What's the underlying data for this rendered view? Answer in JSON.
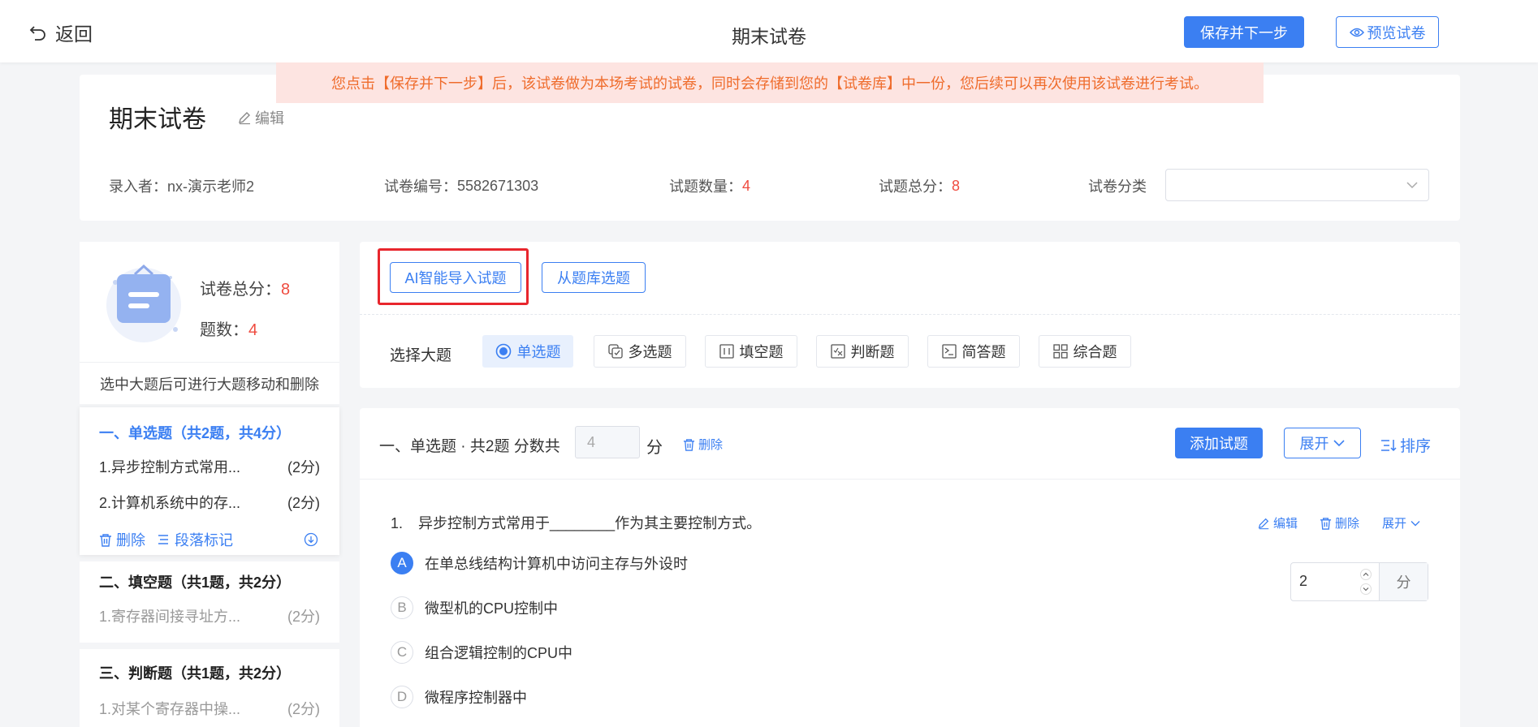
{
  "header": {
    "back_label": "返回",
    "title": "期末试卷",
    "save_next_label": "保存并下一步",
    "preview_label": "预览试卷"
  },
  "notice": "您点击【保存并下一步】后，该试卷做为本场考试的试卷，同时会存储到您的【试卷库】中一份，您后续可以再次使用该试卷进行考试。",
  "paper": {
    "title": "期末试卷",
    "edit_label": "编辑",
    "creator_label": "录入者：",
    "creator": "nx-演示老师2",
    "code_label": "试卷编号：",
    "code": "5582671303",
    "count_label": "试题数量：",
    "count": "4",
    "total_label": "试题总分：",
    "total": "8",
    "category_label": "试卷分类",
    "category_value": ""
  },
  "sidebar": {
    "total_label": "试卷总分：",
    "total": "8",
    "count_label": "题数：",
    "count": "4",
    "hint": "选中大题后可进行大题移动和删除",
    "sections": [
      {
        "title": "一、单选题（共2题，共4分）",
        "items": [
          {
            "text": "1.异步控制方式常用...",
            "score": "(2分)"
          },
          {
            "text": "2.计算机系统中的存...",
            "score": "(2分)"
          }
        ],
        "delete_label": "删除",
        "mark_label": "段落标记"
      },
      {
        "title": "二、填空题（共1题，共2分）",
        "items": [
          {
            "text": "1.寄存器间接寻址方...",
            "score": "(2分)"
          }
        ]
      },
      {
        "title": "三、判断题（共1题，共2分）",
        "items": [
          {
            "text": "1.对某个寄存器中操...",
            "score": "(2分)"
          }
        ]
      }
    ]
  },
  "toolbar": {
    "ai_import_label": "AI智能导入试题",
    "from_bank_label": "从题库选题",
    "choose_label": "选择大题",
    "types": [
      {
        "label": "单选题",
        "icon": "radio-icon",
        "active": true
      },
      {
        "label": "多选题",
        "icon": "multi-select-icon",
        "active": false
      },
      {
        "label": "填空题",
        "icon": "fill-blank-icon",
        "active": false
      },
      {
        "label": "判断题",
        "icon": "judge-icon",
        "active": false
      },
      {
        "label": "简答题",
        "icon": "short-answer-icon",
        "active": false
      },
      {
        "label": "综合题",
        "icon": "grid-icon",
        "active": false
      }
    ]
  },
  "question_section": {
    "label": "一、单选题 · 共2题 分数共",
    "score_placeholder": "4",
    "unit": "分",
    "delete_label": "删除",
    "add_label": "添加试题",
    "expand_label": "展开",
    "sort_label": "排序"
  },
  "question": {
    "number": "1.",
    "stem": "异步控制方式常用于________作为其主要控制方式。",
    "edit_label": "编辑",
    "delete_label": "删除",
    "expand_label": "展开",
    "score": "2",
    "score_unit": "分",
    "options": [
      {
        "key": "A",
        "text": "在单总线结构计算机中访问主存与外设时",
        "selected": true
      },
      {
        "key": "B",
        "text": "微型机的CPU控制中",
        "selected": false
      },
      {
        "key": "C",
        "text": "组合逻辑控制的CPU中",
        "selected": false
      },
      {
        "key": "D",
        "text": "微程序控制器中",
        "selected": false
      }
    ]
  },
  "colors": {
    "accent": "#3b7ff2",
    "red": "#ef4b3f",
    "notice_bg": "#fde4e1",
    "notice_text": "#ef6c2c",
    "highlight_frame": "#e8262d"
  }
}
